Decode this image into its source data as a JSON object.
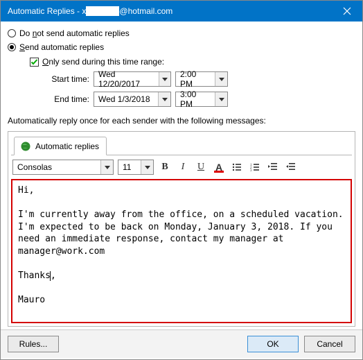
{
  "title": {
    "prefix": "Automatic Replies - x",
    "email_domain": "@hotmail.com"
  },
  "radios": {
    "do_not_send": "Do not send automatic replies",
    "send": "Send automatic replies"
  },
  "only_during_label": "Only send during this time range:",
  "start_label": "Start time:",
  "end_label": "End time:",
  "start_date": "Wed 12/20/2017",
  "start_time": "2:00 PM",
  "end_date": "Wed 1/3/2018",
  "end_time": "3:00 PM",
  "reply_once_label": "Automatically reply once for each sender with the following messages:",
  "tab_label": "Automatic replies",
  "font_name": "Consolas",
  "font_size": "11",
  "message_body": "Hi,\n\nI'm currently away from the office, on a scheduled vacation. I'm expected to be back on Monday, January 3, 2018. If you need an immediate response, contact my manager at manager@work.com\n\nThanks",
  "message_tail": ",\n\nMauro",
  "buttons": {
    "rules": "Rules...",
    "ok": "OK",
    "cancel": "Cancel"
  }
}
